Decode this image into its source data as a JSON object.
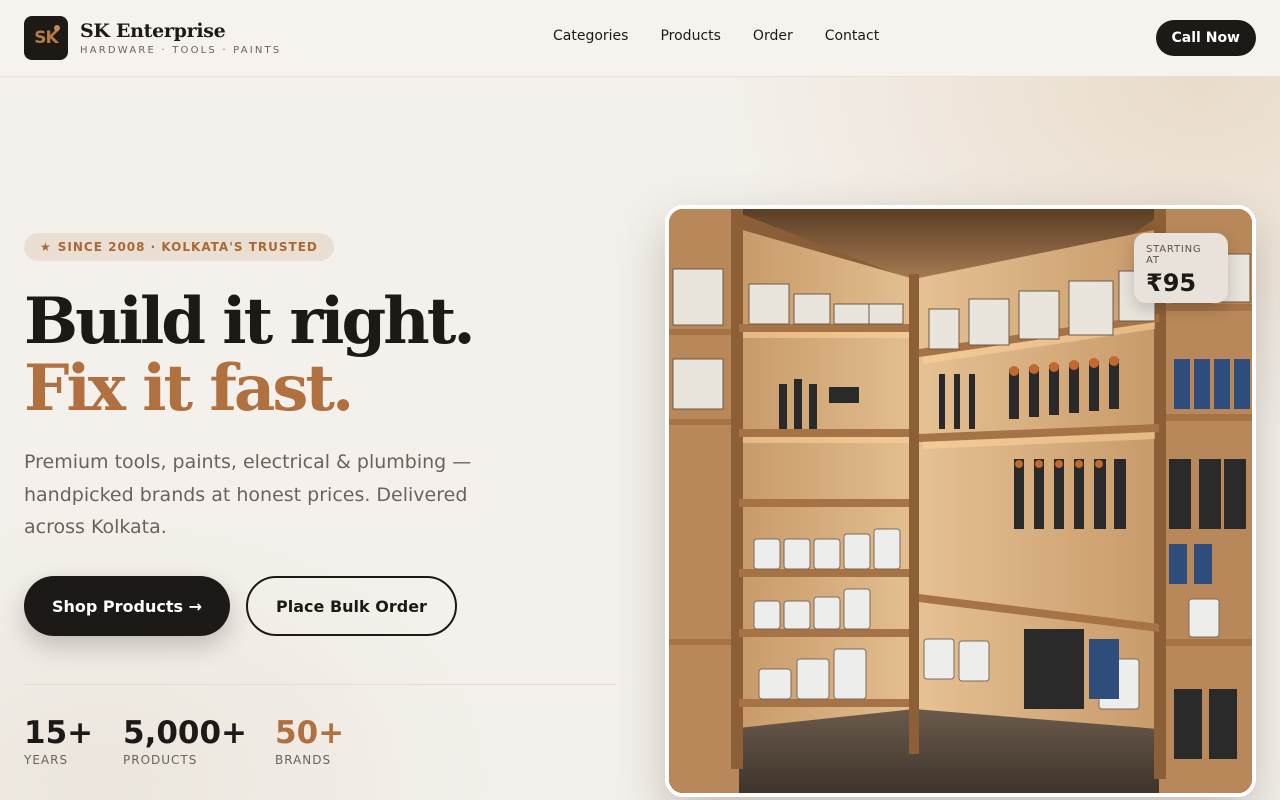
{
  "header": {
    "logo_text": "SK",
    "brand_name": "SK Enterprise",
    "brand_tagline": "HARDWARE · TOOLS · PAINTS",
    "nav": [
      {
        "label": "Categories"
      },
      {
        "label": "Products"
      },
      {
        "label": "Order"
      },
      {
        "label": "Contact"
      }
    ],
    "cta_label": "Call Now"
  },
  "hero": {
    "badge_icon": "★",
    "badge_text": "SINCE 2008 · KOLKATA'S TRUSTED",
    "headline_line1": "Build it right.",
    "headline_line2": "Fix it fast.",
    "lead": "Premium tools, paints, electrical & plumbing — handpicked brands at honest prices. Delivered across Kolkata.",
    "primary_button": "Shop Products →",
    "secondary_button": "Place Bulk Order",
    "stats": [
      {
        "value": "15+",
        "label": "YEARS"
      },
      {
        "value": "5,000+",
        "label": "PRODUCTS"
      },
      {
        "value": "50+",
        "label": "BRANDS"
      }
    ]
  },
  "showcase": {
    "price_caption": "STARTING AT",
    "price_value": "₹95"
  },
  "colors": {
    "accent": "#b0703f",
    "dark": "#1c1917",
    "background": "#f4f1ec"
  }
}
